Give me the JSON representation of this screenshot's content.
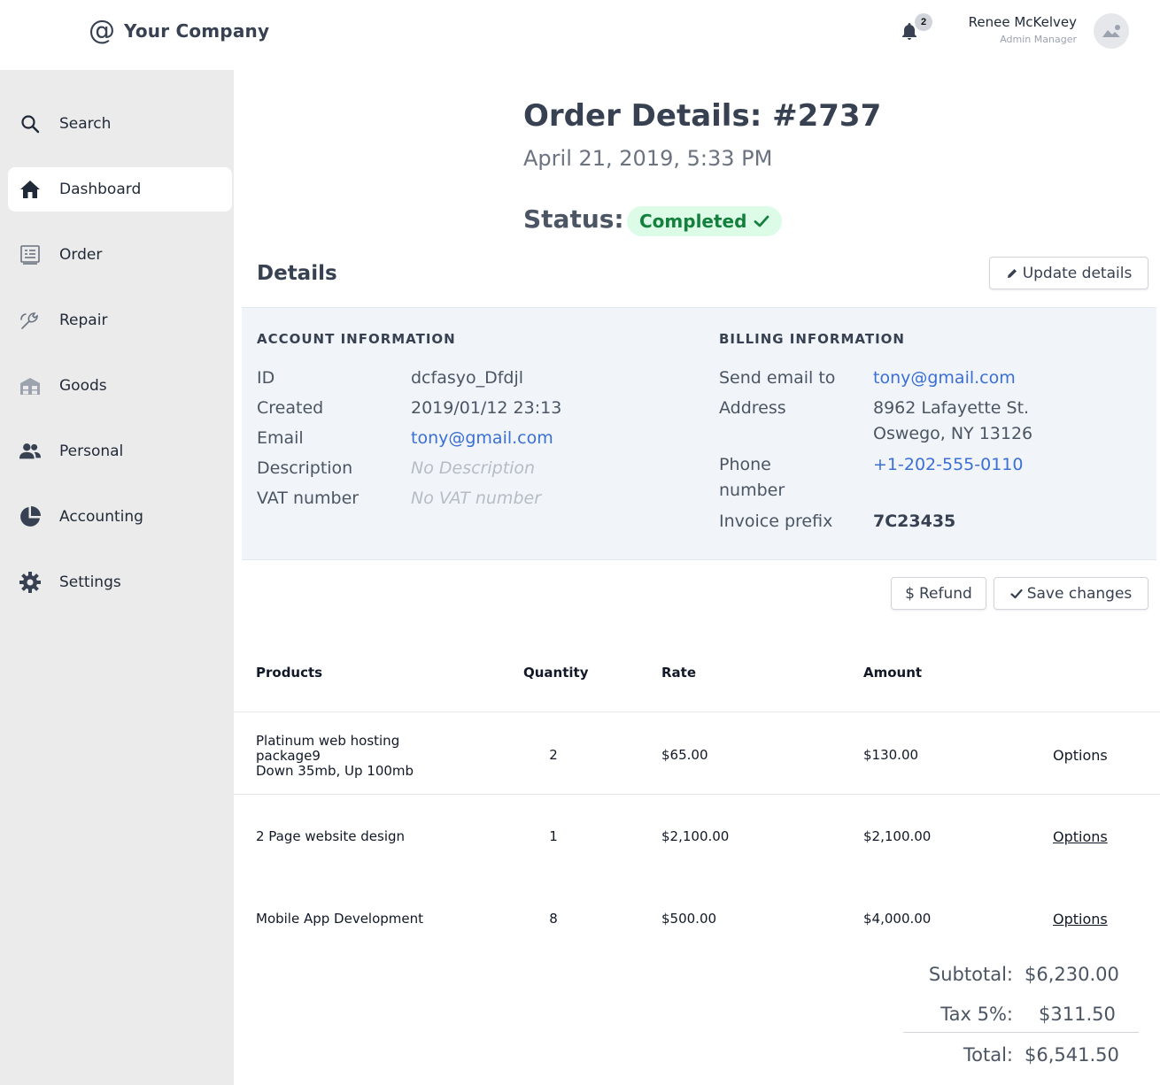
{
  "header": {
    "company": "Your Company",
    "notification_count": "2",
    "user_name": "Renee McKelvey",
    "user_role": "Admin Manager"
  },
  "sidebar": {
    "items": [
      {
        "label": "Search",
        "icon": "search-icon"
      },
      {
        "label": "Dashboard",
        "icon": "home-icon",
        "active": true
      },
      {
        "label": "Order",
        "icon": "receipt-icon"
      },
      {
        "label": "Repair",
        "icon": "wrench-icon"
      },
      {
        "label": "Goods",
        "icon": "warehouse-icon"
      },
      {
        "label": "Personal",
        "icon": "people-icon"
      },
      {
        "label": "Accounting",
        "icon": "pie-chart-icon"
      },
      {
        "label": "Settings",
        "icon": "gear-icon"
      }
    ]
  },
  "order": {
    "title": "Order Details: #2737",
    "date": "April 21, 2019, 5:33 PM",
    "status_label": "Status:",
    "status": "Completed"
  },
  "details": {
    "title": "Details",
    "update_button": "Update details",
    "account": {
      "heading": "ACCOUNT INFORMATION",
      "id_label": "ID",
      "id": "dcfasyo_Dfdjl",
      "created_label": "Created",
      "created": "2019/01/12 23:13",
      "email_label": "Email",
      "email": "tony@gmail.com",
      "description_label": "Description",
      "description": "No Description",
      "vat_label": "VAT number",
      "vat": "No VAT number"
    },
    "billing": {
      "heading": "BILLING INFORMATION",
      "send_label": "Send email to",
      "send": "tony@gmail.com",
      "address_label": "Address",
      "address_line1": "8962 Lafayette St.",
      "address_line2": "Oswego, NY 13126",
      "phone_label_1": "Phone",
      "phone_label_2": "number",
      "phone": "+1-202-555-0110",
      "prefix_label": "Invoice prefix",
      "prefix": "7C23435"
    }
  },
  "actions": {
    "refund": "Refund",
    "save": "Save changes"
  },
  "table": {
    "headers": [
      "Products",
      "Quantity",
      "Rate",
      "Amount"
    ],
    "rows": [
      {
        "product_lines": [
          "Platinum web hosting",
          "package9",
          "Down 35mb, Up 100mb"
        ],
        "quantity": "2",
        "rate": "$65.00",
        "amount": "$130.00",
        "options": "Options"
      },
      {
        "product_lines": [
          "2 Page website design"
        ],
        "quantity": "1",
        "rate": "$2,100.00",
        "amount": "$2,100.00",
        "options": "Options"
      },
      {
        "product_lines": [
          "Mobile App Development"
        ],
        "quantity": "8",
        "rate": "$500.00",
        "amount": "$4,000.00",
        "options": "Options"
      }
    ]
  },
  "totals": {
    "subtotal_label": "Subtotal:",
    "subtotal": "$6,230.00",
    "tax_label": "Tax 5%:",
    "tax": "$311.50",
    "total_label": "Total:",
    "total": "$6,541.50"
  },
  "colors": {
    "sidebar_bg": "#ebebeb",
    "status_bg": "#dcfce7",
    "status_text": "#15803d",
    "link": "#3b6fd4",
    "panel_bg": "#f1f5f9"
  }
}
